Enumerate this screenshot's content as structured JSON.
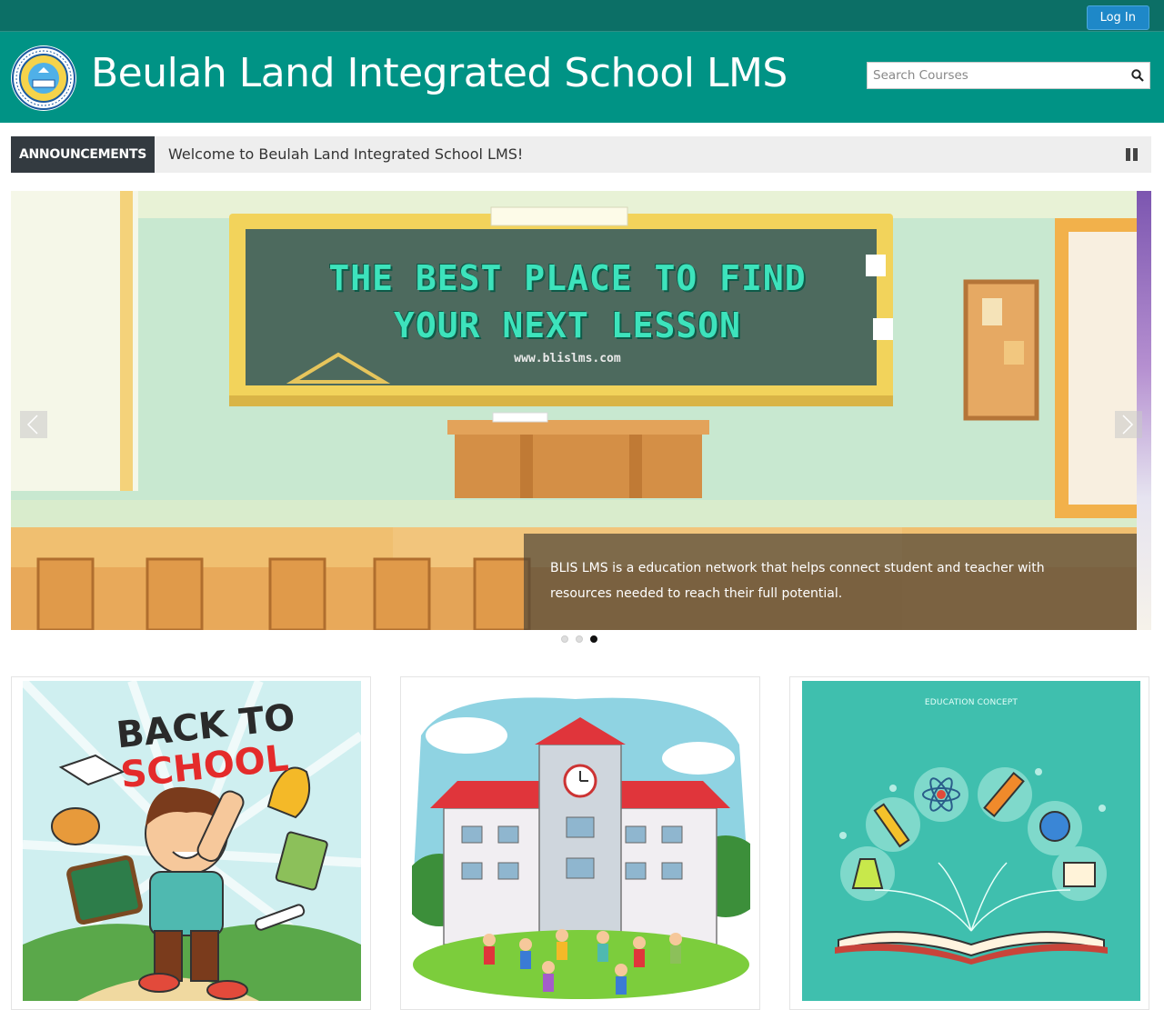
{
  "topbar": {
    "login_label": "Log In"
  },
  "header": {
    "title": "Beulah Land Integrated School LMS",
    "search_placeholder": "Search Courses"
  },
  "announcements": {
    "label": "ANNOUNCEMENTS",
    "text": "Welcome to Beulah Land Integrated School LMS!"
  },
  "slider": {
    "heading_line1": "THE BEST PLACE TO FIND",
    "heading_line2": "YOUR NEXT LESSON",
    "url": "www.blislms.com",
    "caption": "BLIS LMS is a education network that helps connect student and teacher with resources needed to reach their full potential.",
    "slide_count": 3,
    "active_slide": 3
  },
  "cards": [
    {
      "image_title_line1": "BACK TO",
      "image_title_line2": "SCHOOL"
    },
    {
      "image": "school-building-illustration"
    },
    {
      "image_label": "EDUCATION CONCEPT"
    }
  ],
  "colors": {
    "topbar": "#0c6f66",
    "header": "#009385",
    "login": "#1e88c8",
    "announcement_label": "#333a40"
  }
}
